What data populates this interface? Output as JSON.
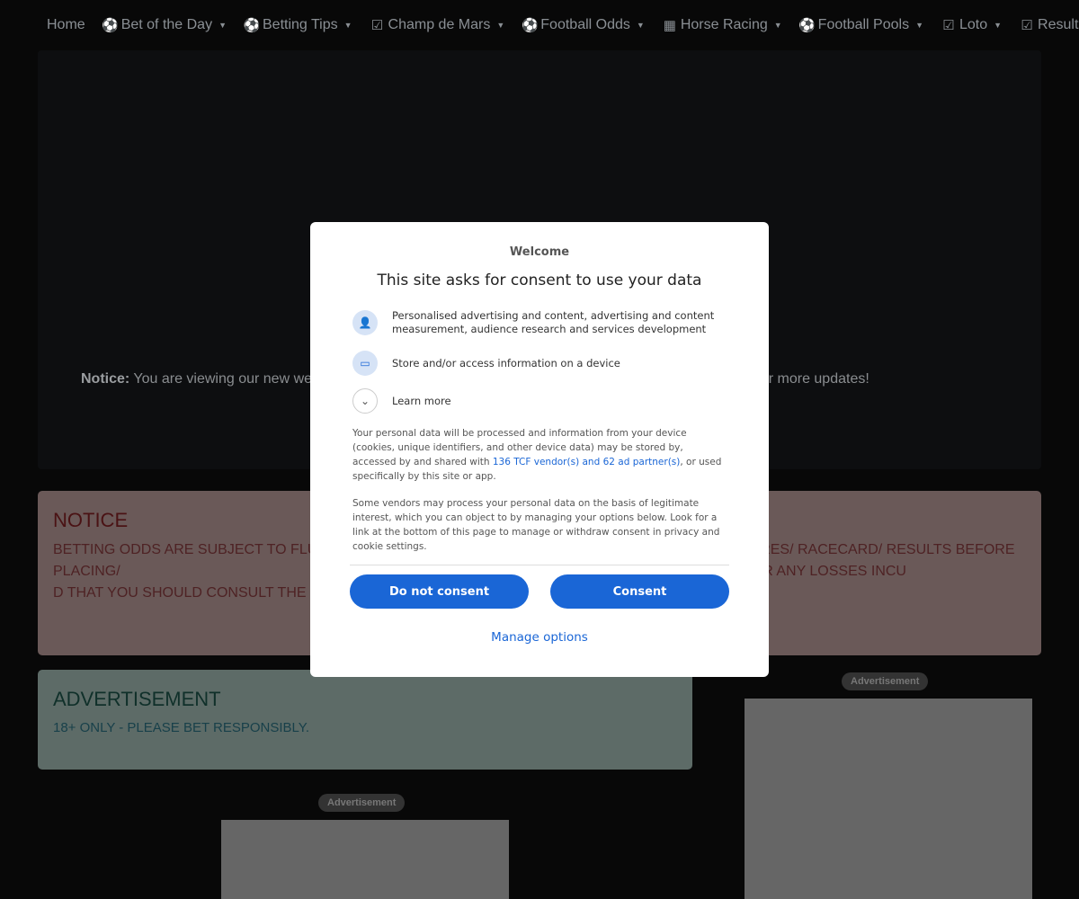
{
  "nav": {
    "items": [
      {
        "label": "Home",
        "icon": ""
      },
      {
        "label": "Bet of the Day",
        "icon": "soccer-ball-icon"
      },
      {
        "label": "Betting Tips",
        "icon": "soccer-ball-icon"
      },
      {
        "label": "Champ de Mars",
        "icon": "calendar-check-icon"
      },
      {
        "label": "Football Odds",
        "icon": "soccer-ball-icon"
      },
      {
        "label": "Horse Racing",
        "icon": "table-icon"
      },
      {
        "label": "Football Pools",
        "icon": "soccer-ball-icon"
      },
      {
        "label": "Loto",
        "icon": "calendar-check-icon"
      },
      {
        "label": "Results",
        "icon": "calendar-check-icon"
      }
    ]
  },
  "hero": {
    "notice_label": "Notice:",
    "notice_text": " You are viewing our new we                                                                                      me. Stay tuned for more updates!"
  },
  "notice": {
    "title": "NOTICE",
    "text": "BETTING ODDS ARE SUBJECT TO FLUCTU                                                            E OFFICIAL ODDS/ FIXTURES/ RACECARD/ RESULTS BEFORE PLACING/                                                          ES ONLY AND THAT WE WILL TAKE NO RESPONSIBILITY FOR ANY LOSSES INCU                                                    D THAT YOU SHOULD CONSULT THE OFFICIAL RESULT. 18+ ONLY - PLEASE BE"
  },
  "ad": {
    "title": "ADVERTISEMENT",
    "text": "18+ ONLY - PLEASE BET RESPONSIBLY.",
    "label": "Advertisement"
  },
  "consent": {
    "welcome": "Welcome",
    "title": "This site asks for consent to use your data",
    "purposes": [
      {
        "icon": "person-icon",
        "text": "Personalised advertising and content, advertising and content measurement, audience research and services development"
      },
      {
        "icon": "devices-icon",
        "text": "Store and/or access information on a device"
      },
      {
        "icon": "chevron-down-icon",
        "text": "Learn more"
      }
    ],
    "para1_a": "Your personal data will be processed and information from your device (cookies, unique identifiers, and other device data) may be stored by, accessed by and shared with ",
    "para1_link": "136 TCF vendor(s) and 62 ad partner(s)",
    "para1_b": ", or used specifically by this site or app.",
    "para2": "Some vendors may process your personal data on the basis of legitimate interest, which you can object to by managing your options below. Look for a link at the bottom of this page to manage or withdraw consent in privacy and cookie settings.",
    "do_not_consent": "Do not consent",
    "consent": "Consent",
    "manage": "Manage options"
  },
  "colors": {
    "accent": "#1a66d6"
  }
}
